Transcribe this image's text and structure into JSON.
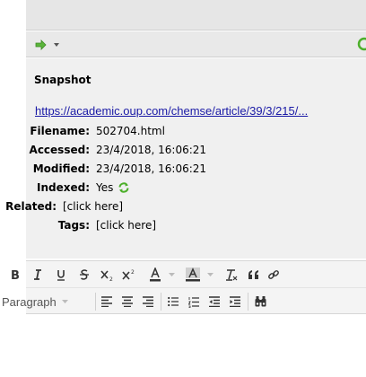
{
  "snapshot": {
    "title": "Snapshot",
    "url": "https://academic.oup.com/chemse/article/39/3/215/...",
    "fields": [
      {
        "label": "Filename:",
        "value": "502704.html"
      },
      {
        "label": "Accessed:",
        "value": "23/4/2018, 16:06:21"
      },
      {
        "label": "Modified:",
        "value": "23/4/2018, 16:06:21"
      },
      {
        "label": "Indexed:",
        "value": "Yes"
      },
      {
        "label": "Related:",
        "value": "[click here]"
      },
      {
        "label": "Tags:",
        "value": "[click here]"
      }
    ]
  },
  "editor": {
    "format_select": "Paragraph",
    "toolbar_row1": [
      "bold-icon",
      "italic-icon",
      "underline-icon",
      "strikethrough-icon",
      "subscript-icon",
      "superscript-icon",
      "text-color-icon",
      "dropdown-icon",
      "background-color-icon",
      "dropdown-icon",
      "clear-formatting-icon",
      "blockquote-icon",
      "link-icon"
    ],
    "toolbar_row2": [
      "align-left-icon",
      "align-center-icon",
      "align-right-icon",
      "bullet-list-icon",
      "numbered-list-icon",
      "outdent-icon",
      "indent-icon",
      "find-replace-icon"
    ]
  },
  "colors": {
    "link": "#1a1aa6",
    "accent_green": "#4caf2a",
    "panel_bg": "#f0f0f0",
    "toolbar_bg": "#f4f4f4"
  }
}
